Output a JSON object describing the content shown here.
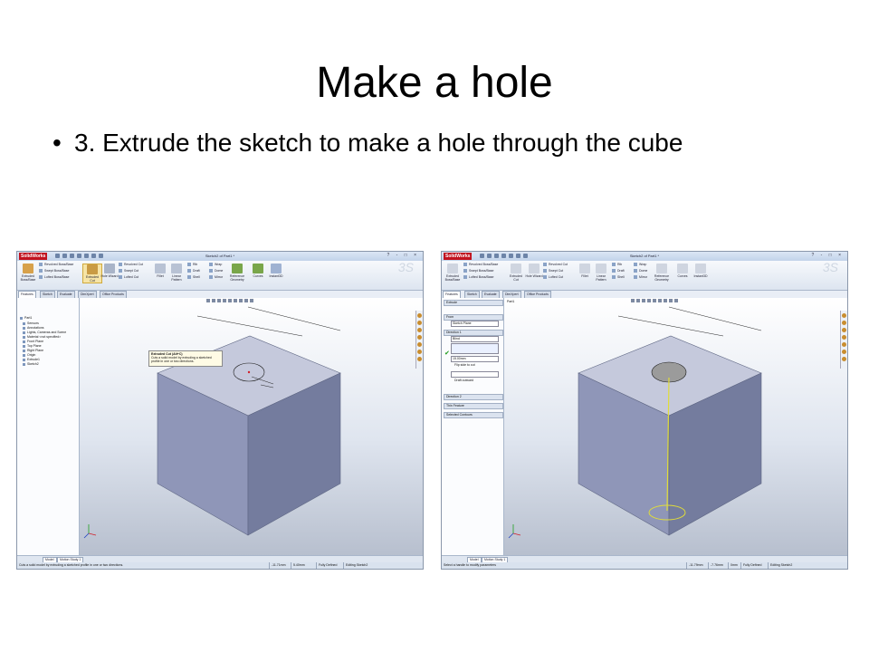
{
  "slide": {
    "title": "Make a hole",
    "bullet_glyph": "•",
    "bullet": "3. Extrude the sketch to make a hole through the cube"
  },
  "screens": {
    "left": {
      "app_logo": "SolidWorks",
      "doc_title": "Sketch2 of Part1 *",
      "window_buttons": "? - □ ×",
      "ribbon": {
        "extruded_boss": "Extruded Boss/Base",
        "revolved_boss": "Revolved Boss/Base",
        "swept_boss": "Swept Boss/Base",
        "lofted_boss": "Lofted Boss/Base",
        "extruded_cut": "Extruded Cut",
        "hole_wizard": "Hole Wizard",
        "revolved_cut": "Revolved Cut",
        "swept_cut": "Swept Cut",
        "lofted_cut": "Lofted Cut",
        "fillet": "Fillet",
        "linear_pattern": "Linear Pattern",
        "rib": "Rib",
        "draft": "Draft",
        "shell": "Shell",
        "wrap": "Wrap",
        "dome": "Dome",
        "mirror": "Mirror",
        "reference_geometry": "Reference Geometry",
        "curves": "Curves",
        "instant3d": "Instant3D"
      },
      "tabs": [
        "Features",
        "Sketch",
        "Evaluate",
        "DimXpert",
        "Office Products"
      ],
      "tooltip": {
        "title": "Extruded Cut (Alt+C)",
        "body": "Cuts a solid model by extruding a sketched profile in one or two directions."
      },
      "tree": [
        "Part1",
        "Sensors",
        "Annotations",
        "Lights, Cameras and Scene",
        "Material <not specified>",
        "Front Plane",
        "Top Plane",
        "Right Plane",
        "Origin",
        "Extrude1",
        "Sketch2"
      ],
      "bottom_tabs": [
        "Model",
        "Motion Study 1"
      ],
      "status": {
        "message": "Cuts a solid model by extruding a sketched profile in one or two directions.",
        "x": "-11.71mm",
        "y": "5.40mm",
        "state": "Fully Defined",
        "editing": "Editing Sketch2"
      }
    },
    "right": {
      "app_logo": "SolidWorks",
      "doc_title": "Sketch2 of Part1 *",
      "window_buttons": "? - □ ×",
      "tabs": [
        "Features",
        "Sketch",
        "Evaluate",
        "DimXpert",
        "Office Products"
      ],
      "breadcrumb": "Part1",
      "pm": {
        "title": "Extrude",
        "from_header": "From",
        "from_value": "Sketch Plane",
        "dir1_header": "Direction 1",
        "end_condition": "Blind",
        "depth": "15.00mm",
        "flip_side": "Flip side to cut",
        "draft_outward": "Draft outward",
        "dir2_header": "Direction 2",
        "thin_feature": "Thin Feature",
        "selected_contours": "Selected Contours"
      },
      "bottom_tabs": [
        "Model",
        "Motion Study 1"
      ],
      "status": {
        "message": "Select a handle to modify parameters",
        "x": "-11.79mm",
        "y": "-7.76mm",
        "z": "0mm",
        "state": "Fully Defined",
        "editing": "Editing Sketch2"
      }
    }
  },
  "colors": {
    "cube_top": "#c5c9dc",
    "cube_left": "#8f96b8",
    "cube_right": "#747c9e",
    "hole_fill": "#9b9b9b",
    "preview_ring": "#e0dc3a",
    "accent_red": "#c1121f"
  }
}
